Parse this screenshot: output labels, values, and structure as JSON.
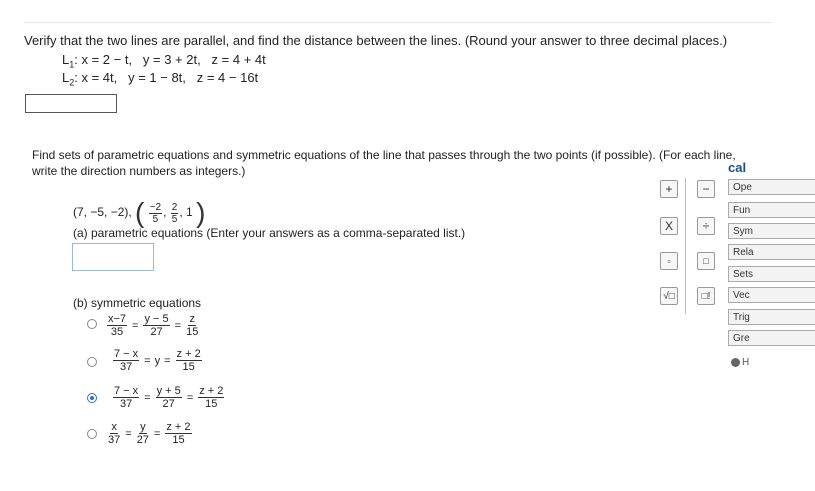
{
  "q1": {
    "prompt": "Verify that the two lines are parallel, and find the distance between the lines. (Round your answer to three decimal places.)",
    "line1": "L: x = 2 − t,   y = 3 + 2t,   z = 4 + 4t",
    "line1_sub": "1",
    "line1_rest": ": x = 2 − t,   y = 3 + 2t,   z = 4 + 4t",
    "line2_sub": "2",
    "line2_rest": ": x = 4t,   y = 1 − 8t,   z = 4 − 16t",
    "answer": ""
  },
  "q2": {
    "prompt_1": "Find sets of parametric equations and symmetric equations of the line that passes through the two points (if possible). (For each line,",
    "prompt_2": "write the direction numbers as integers.)",
    "point1": "(7, −5, −2),",
    "p2_x_num": "−2",
    "p2_x_den": "5",
    "p2_y_num": "2",
    "p2_y_den": "5",
    "p2_z": "1",
    "part_a": "(a) parametric equations (Enter your answers as a comma-separated list.)",
    "part_a_answer": "",
    "part_b": "(b) symmetric equations",
    "options": [
      {
        "a_num": "x−7",
        "a_den": "35",
        "b_num": "y − 5",
        "b_den": "27",
        "c_num": "z",
        "c_den": "15",
        "selected": false
      },
      {
        "a_num": "7 − x",
        "a_den": "37",
        "mid": "y",
        "c_num": "z + 2",
        "c_den": "15",
        "selected": false
      },
      {
        "a_num": "7 − x",
        "a_den": "37",
        "b_num": "y + 5",
        "b_den": "27",
        "c_num": "z + 2",
        "c_den": "15",
        "selected": true
      },
      {
        "a_num": "x",
        "a_den": "37",
        "b_num": "y",
        "b_den": "27",
        "c_num": "z + 2",
        "c_den": "15",
        "selected": false
      }
    ]
  },
  "palette": {
    "title": "cal",
    "plus": "+",
    "minus": "−",
    "times": "X",
    "divide": "÷",
    "fraction": "▫",
    "power": "□",
    "sqrt": "√□",
    "factorial": "□!",
    "tabs": [
      "Ope",
      "Fun",
      "Sym",
      "Rela",
      "Sets",
      "Vec",
      "Trig",
      "Gre"
    ],
    "help": "H"
  }
}
